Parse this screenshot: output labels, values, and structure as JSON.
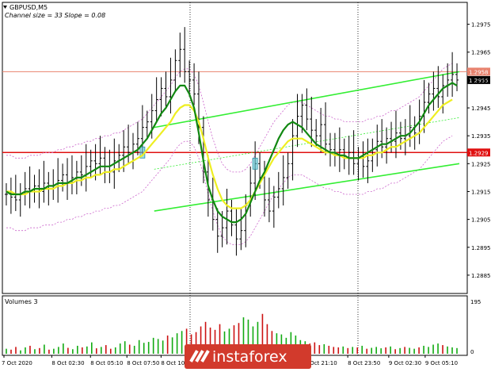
{
  "chart_data": {
    "type": "candlestick",
    "symbol_timeframe": "GBPUSD,M5",
    "indicator_note": "Channel size = 33 Slope = 0.08",
    "volume_label": "Volumes 3",
    "price_axis_ticks": [
      "1.2975",
      "1.2965",
      "1.2955",
      "1.2945",
      "1.2935",
      "1.2925",
      "1.2915",
      "1.2905",
      "1.2895",
      "1.2885"
    ],
    "price_axis_values": [
      1.2975,
      1.2965,
      1.2955,
      1.2945,
      1.2935,
      1.2925,
      1.2915,
      1.2905,
      1.2895,
      1.2885
    ],
    "ylim": [
      1.2879,
      1.2982
    ],
    "volume_ticks": [
      "195",
      "0"
    ],
    "volume_ylim": [
      0,
      195
    ],
    "time_labels": [
      "7 Oct 2020",
      "8 Oct 02:30",
      "8 Oct 05:10",
      "8 Oct 07:50",
      "8 Oct 10:",
      "8 Oct 21:10",
      "8 Oct 23:50",
      "9 Oct 02:30",
      "9 Oct 05:10"
    ],
    "price_lines": [
      {
        "label": "1.2958",
        "value": 1.2958,
        "color": "#e8826e"
      },
      {
        "label": "1.2929",
        "value": 1.2929,
        "color": "#e01010"
      }
    ],
    "current_price": {
      "label": "1.2955",
      "value": 1.2955
    },
    "channel_lines": [
      {
        "name": "upper",
        "points": [
          [
            0.33,
            1.2938
          ],
          [
            1.0,
            1.2958
          ]
        ]
      },
      {
        "name": "lower",
        "points": [
          [
            0.33,
            1.2908
          ],
          [
            1.0,
            1.2925
          ]
        ]
      }
    ],
    "series": [
      {
        "name": "Close",
        "values": [
          1.2914,
          1.2913,
          1.2912,
          1.2914,
          1.2916,
          1.2915,
          1.2917,
          1.2915,
          1.2918,
          1.2916,
          1.2917,
          1.2919,
          1.2921,
          1.2918,
          1.292,
          1.2922,
          1.2921,
          1.2924,
          1.2926,
          1.2925,
          1.2927,
          1.2924,
          1.2922,
          1.2926,
          1.2928,
          1.2931,
          1.2929,
          1.2932,
          1.2934,
          1.2938,
          1.294,
          1.2944,
          1.2948,
          1.2952,
          1.2949,
          1.2955,
          1.2962,
          1.2966,
          1.2958,
          1.2955,
          1.295,
          1.2938,
          1.2922,
          1.2912,
          1.2905,
          1.2899,
          1.2902,
          1.2908,
          1.2903,
          1.2898,
          1.2901,
          1.291,
          1.2918,
          1.2925,
          1.292,
          1.2912,
          1.2908,
          1.2913,
          1.2916,
          1.292,
          1.2925,
          1.2935,
          1.2942,
          1.2946,
          1.2941,
          1.2937,
          1.2935,
          1.2939,
          1.2932,
          1.293,
          1.2928,
          1.293,
          1.2927,
          1.2929,
          1.2925,
          1.2927,
          1.2924,
          1.2926,
          1.293,
          1.2933,
          1.2931,
          1.2934,
          1.2933,
          1.2936,
          1.2934,
          1.2935,
          1.2938,
          1.2936,
          1.2942,
          1.2947,
          1.295,
          1.2952,
          1.2949,
          1.2953,
          1.2955,
          1.2957,
          1.2955
        ]
      },
      {
        "name": "MA-green",
        "values": [
          1.2915,
          1.2914,
          1.2914,
          1.2914,
          1.2915,
          1.2915,
          1.2916,
          1.2916,
          1.2916,
          1.2917,
          1.2917,
          1.2918,
          1.2918,
          1.2918,
          1.2919,
          1.292,
          1.292,
          1.2921,
          1.2922,
          1.2923,
          1.2924,
          1.2924,
          1.2924,
          1.2925,
          1.2926,
          1.2927,
          1.2928,
          1.2929,
          1.293,
          1.2932,
          1.2934,
          1.2937,
          1.294,
          1.2943,
          1.2945,
          1.2948,
          1.2951,
          1.2953,
          1.2953,
          1.295,
          1.2945,
          1.2936,
          1.2926,
          1.2917,
          1.2912,
          1.2908,
          1.2906,
          1.2905,
          1.2904,
          1.2904,
          1.2905,
          1.2907,
          1.2911,
          1.2915,
          1.2919,
          1.2922,
          1.2926,
          1.293,
          1.2934,
          1.2937,
          1.2939,
          1.294,
          1.2939,
          1.2938,
          1.2936,
          1.2934,
          1.2932,
          1.2931,
          1.293,
          1.2929,
          1.2929,
          1.2928,
          1.2928,
          1.2927,
          1.2927,
          1.2927,
          1.2928,
          1.2929,
          1.293,
          1.2931,
          1.2932,
          1.2932,
          1.2933,
          1.2934,
          1.2935,
          1.2935,
          1.2936,
          1.2938,
          1.294,
          1.2943,
          1.2946,
          1.2948,
          1.295,
          1.2952,
          1.2953,
          1.2954,
          1.2953
        ]
      },
      {
        "name": "MA-yellow",
        "values": [
          1.2915,
          1.2915,
          1.2914,
          1.2914,
          1.2914,
          1.2915,
          1.2915,
          1.2915,
          1.2916,
          1.2916,
          1.2916,
          1.2917,
          1.2917,
          1.2918,
          1.2918,
          1.2919,
          1.2919,
          1.292,
          1.292,
          1.2921,
          1.2921,
          1.2922,
          1.2922,
          1.2923,
          1.2923,
          1.2924,
          1.2925,
          1.2926,
          1.2927,
          1.2928,
          1.293,
          1.2932,
          1.2934,
          1.2936,
          1.2938,
          1.294,
          1.2943,
          1.2945,
          1.2946,
          1.2946,
          1.2944,
          1.294,
          1.2934,
          1.2927,
          1.2921,
          1.2916,
          1.2912,
          1.291,
          1.2909,
          1.2909,
          1.2909,
          1.291,
          1.2912,
          1.2915,
          1.2918,
          1.2921,
          1.2924,
          1.2927,
          1.2929,
          1.2931,
          1.2933,
          1.2934,
          1.2934,
          1.2934,
          1.2933,
          1.2932,
          1.2931,
          1.293,
          1.2929,
          1.2929,
          1.2928,
          1.2928,
          1.2927,
          1.2927,
          1.2927,
          1.2927,
          1.2927,
          1.2928,
          1.2928,
          1.2929,
          1.2929,
          1.293,
          1.2931,
          1.2931,
          1.2932,
          1.2933,
          1.2934,
          1.2935,
          1.2936,
          1.2938,
          1.294,
          1.2942,
          1.2944,
          1.2946,
          1.2947,
          1.2948
        ]
      }
    ],
    "volumes": [
      22,
      18,
      30,
      15,
      28,
      35,
      20,
      25,
      40,
      18,
      22,
      30,
      45,
      26,
      20,
      35,
      28,
      32,
      50,
      24,
      30,
      38,
      22,
      28,
      45,
      55,
      40,
      35,
      60,
      48,
      52,
      70,
      65,
      58,
      80,
      72,
      90,
      100,
      110,
      85,
      95,
      120,
      140,
      115,
      105,
      130,
      98,
      110,
      125,
      135,
      160,
      150,
      120,
      140,
      175,
      130,
      100,
      90,
      85,
      70,
      95,
      80,
      60,
      55,
      45,
      50,
      38,
      42,
      35,
      30,
      28,
      32,
      25,
      30,
      28,
      35,
      22,
      26,
      30,
      24,
      28,
      32,
      20,
      25,
      30,
      26,
      22,
      28,
      35,
      30,
      40,
      45,
      38,
      32,
      28,
      25
    ]
  },
  "watermark": {
    "text": "instaforex"
  },
  "colors": {
    "channel": "#33ee33",
    "ma_green": "#118811",
    "ma_yellow": "#eeee22",
    "envelope": "#cc66cc",
    "red_line": "#dd1010",
    "salmon_line": "#e8826e",
    "vol_up": "#11aa11",
    "vol_down": "#cc1111"
  }
}
